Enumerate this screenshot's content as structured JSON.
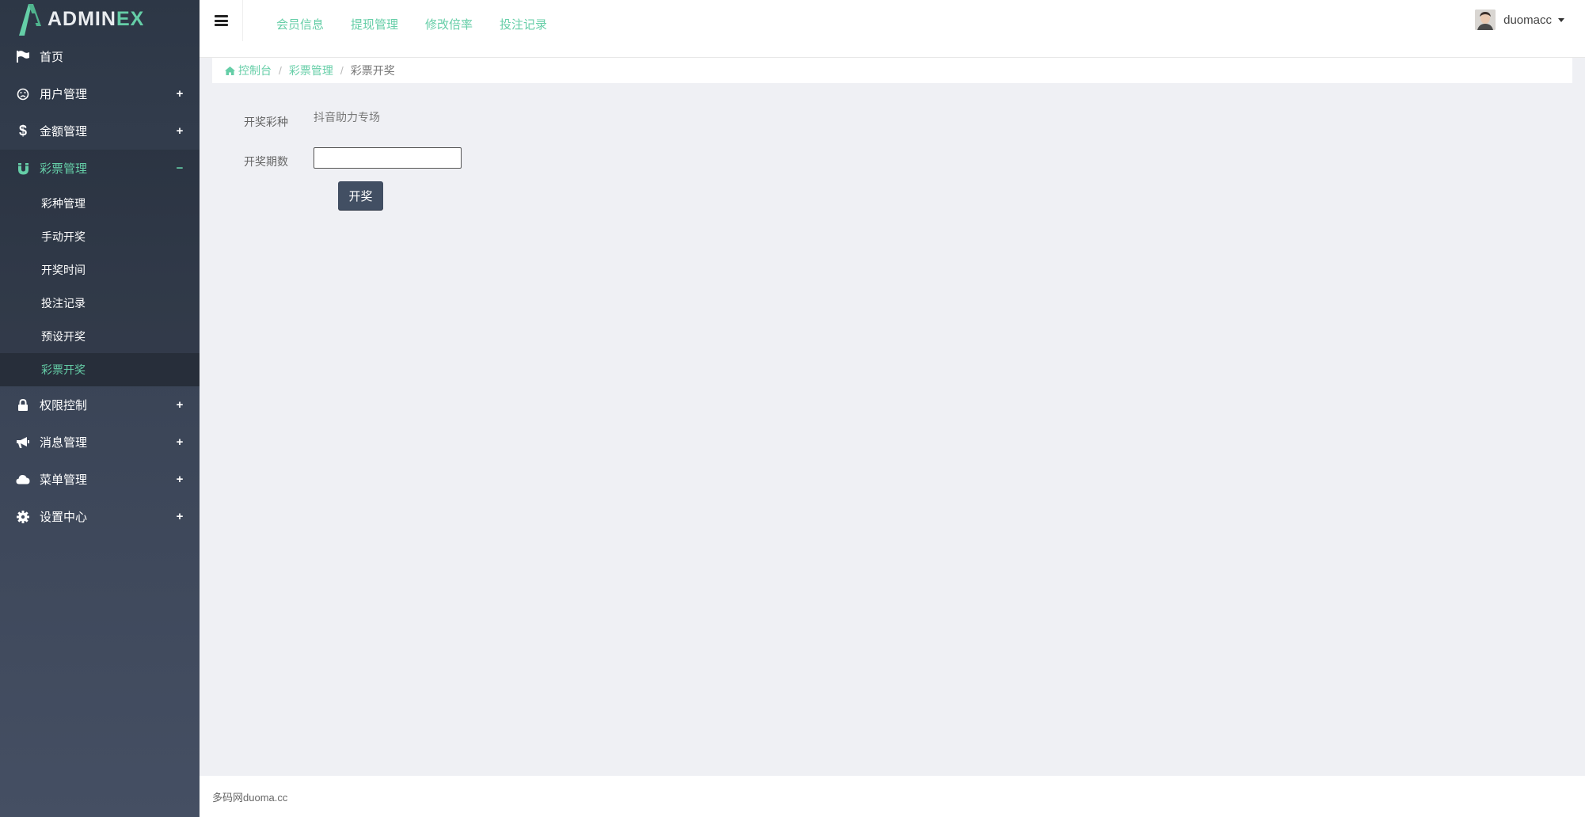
{
  "brand": {
    "name_main": "ADMIN",
    "name_accent": "EX"
  },
  "sidebar": {
    "items": [
      {
        "label": "首页",
        "icon": "flag-icon",
        "toggle": ""
      },
      {
        "label": "用户管理",
        "icon": "frown-icon",
        "toggle": "+"
      },
      {
        "label": "金额管理",
        "icon": "dollar-icon",
        "toggle": "+"
      },
      {
        "label": "彩票管理",
        "icon": "magnet-icon",
        "toggle": "−"
      },
      {
        "label": "权限控制",
        "icon": "lock-icon",
        "toggle": "+"
      },
      {
        "label": "消息管理",
        "icon": "bullhorn-icon",
        "toggle": "+"
      },
      {
        "label": "菜单管理",
        "icon": "cloud-icon",
        "toggle": "+"
      },
      {
        "label": "设置中心",
        "icon": "gear-icon",
        "toggle": "+"
      }
    ],
    "lottery_submenu": [
      "彩种管理",
      "手动开奖",
      "开奖时间",
      "投注记录",
      "预设开奖",
      "彩票开奖"
    ]
  },
  "header": {
    "nav": [
      "会员信息",
      "提现管理",
      "修改倍率",
      "投注记录"
    ],
    "user": {
      "name": "duomacc"
    }
  },
  "breadcrumb": {
    "home": "控制台",
    "section": "彩票管理",
    "current": "彩票开奖"
  },
  "form": {
    "type_label": "开奖彩种",
    "type_value": "抖音助力专场",
    "period_label": "开奖期数",
    "period_value": "",
    "submit_label": "开奖"
  },
  "footer": {
    "text": "多码网duoma.cc"
  },
  "colors": {
    "accent": "#65cea7",
    "sidebar": "#3a4456",
    "button": "#424f63",
    "background": "#eff0f4"
  }
}
